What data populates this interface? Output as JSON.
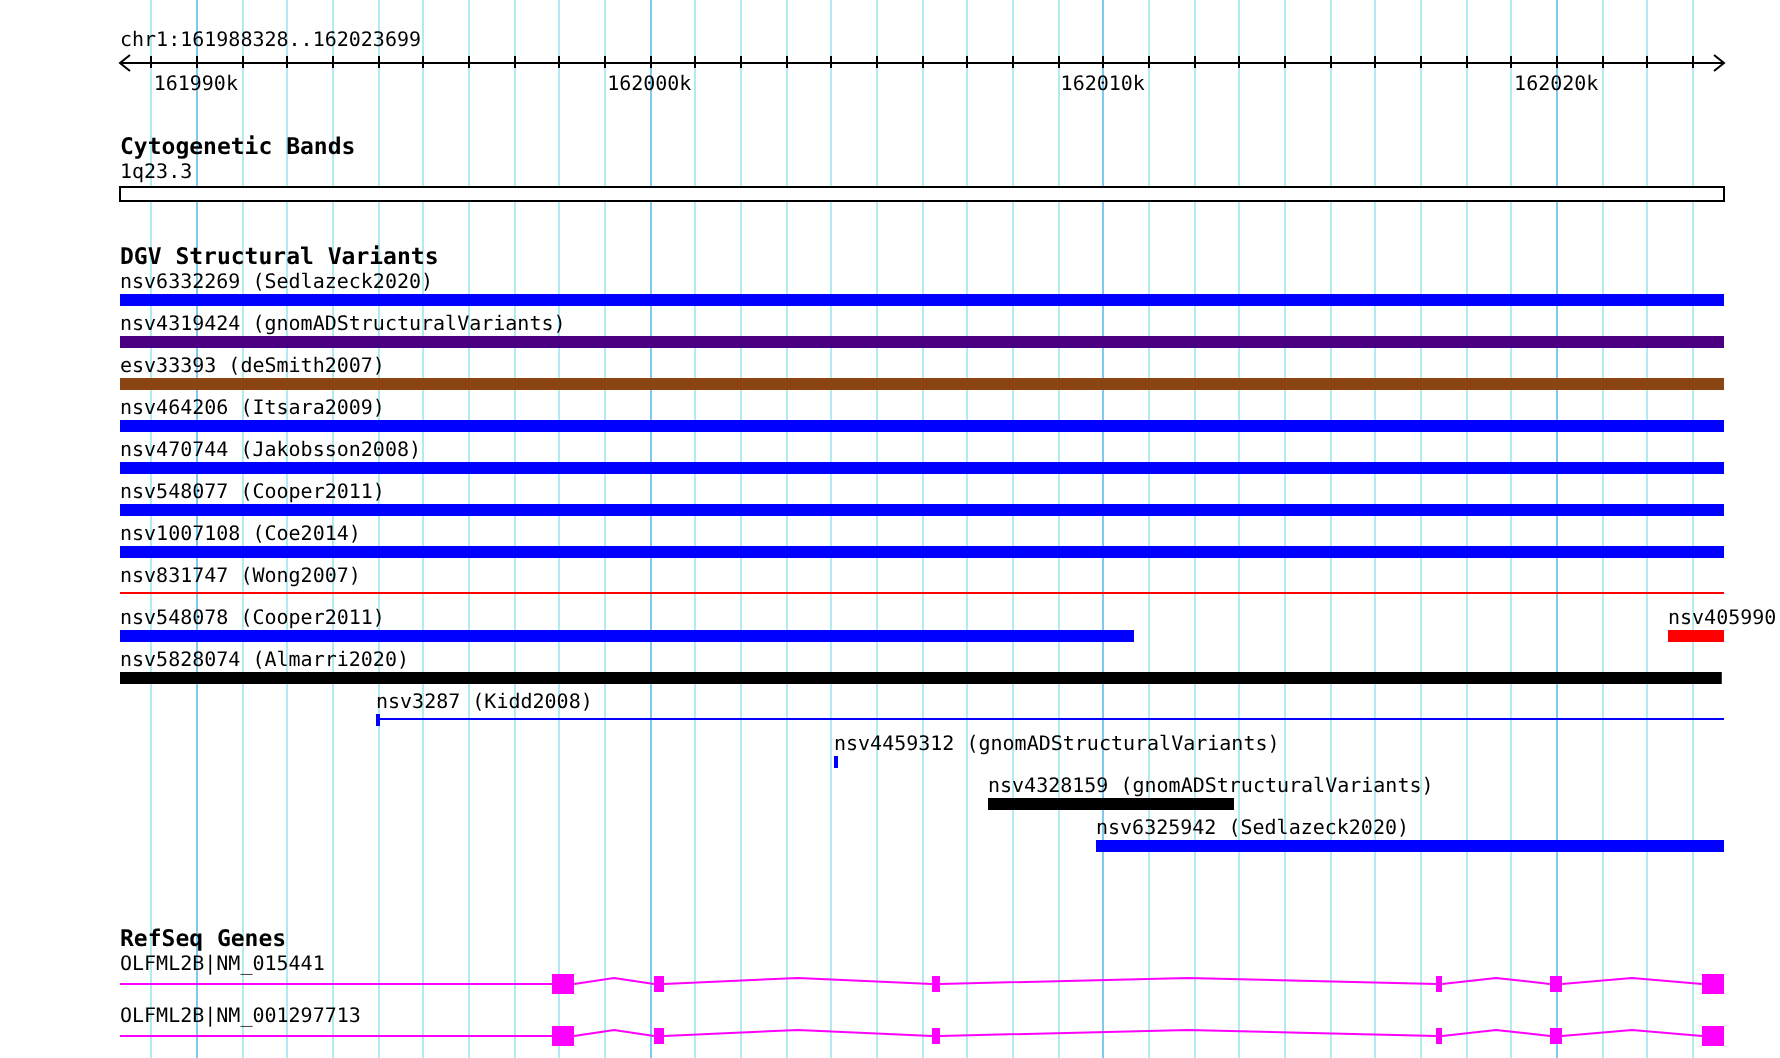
{
  "ruler": {
    "label": "chr1:161988328..162023699",
    "ticks": [
      {
        "label": "161990k"
      },
      {
        "label": "162000k"
      },
      {
        "label": "162010k"
      },
      {
        "label": "162020k"
      }
    ]
  },
  "cytogenetic_bands": {
    "title": "Cytogenetic Bands",
    "band": "1q23.3"
  },
  "structural_variants": {
    "title": "DGV Structural Variants",
    "rows": [
      {
        "features": [
          {
            "kind": "bar",
            "label": "nsv6332269 (Sedlazeck2020)",
            "color": "#0000ff"
          }
        ]
      },
      {
        "features": [
          {
            "kind": "bar",
            "label": "nsv4319424 (gnomADStructuralVariants)",
            "color": "#4b0082"
          }
        ]
      },
      {
        "features": [
          {
            "kind": "bar",
            "label": "esv33393 (deSmith2007)",
            "color": "#8b4513"
          }
        ]
      },
      {
        "features": [
          {
            "kind": "bar",
            "label": "nsv464206 (Itsara2009)",
            "color": "#0000ff"
          }
        ]
      },
      {
        "features": [
          {
            "kind": "bar",
            "label": "nsv470744 (Jakobsson2008)",
            "color": "#0000ff"
          }
        ]
      },
      {
        "features": [
          {
            "kind": "bar",
            "label": "nsv548077 (Cooper2011)",
            "color": "#0000ff"
          }
        ]
      },
      {
        "features": [
          {
            "kind": "bar",
            "label": "nsv1007108 (Coe2014)",
            "color": "#0000ff"
          }
        ]
      },
      {
        "features": [
          {
            "kind": "line",
            "label": "nsv831747 (Wong2007)",
            "color": "#ff0000"
          }
        ]
      },
      {
        "features": [
          {
            "kind": "bar",
            "label": "nsv548078 (Cooper2011)",
            "color": "#0000ff"
          },
          {
            "kind": "bar",
            "label": "nsv405990",
            "color": "#ff0000"
          }
        ]
      },
      {
        "features": [
          {
            "kind": "bar",
            "label": "nsv5828074 (Almarri2020)",
            "color": "#000000"
          }
        ]
      },
      {
        "features": [
          {
            "kind": "line",
            "label": "nsv3287 (Kidd2008)",
            "color": "#0000ff"
          }
        ]
      },
      {
        "features": [
          {
            "kind": "bar",
            "label": "nsv4459312 (gnomADStructuralVariants)",
            "color": "#0000ff"
          }
        ]
      },
      {
        "features": [
          {
            "kind": "bar",
            "label": "nsv4328159 (gnomADStructuralVariants)",
            "color": "#000000"
          }
        ]
      },
      {
        "features": [
          {
            "kind": "bar",
            "label": "nsv6325942 (Sedlazeck2020)",
            "color": "#0000ff"
          }
        ]
      }
    ]
  },
  "refseq_genes": {
    "title": "RefSeq Genes",
    "transcripts": [
      {
        "label": "OLFML2B|NM_015441"
      },
      {
        "label": "OLFML2B|NM_001297713"
      }
    ]
  }
}
